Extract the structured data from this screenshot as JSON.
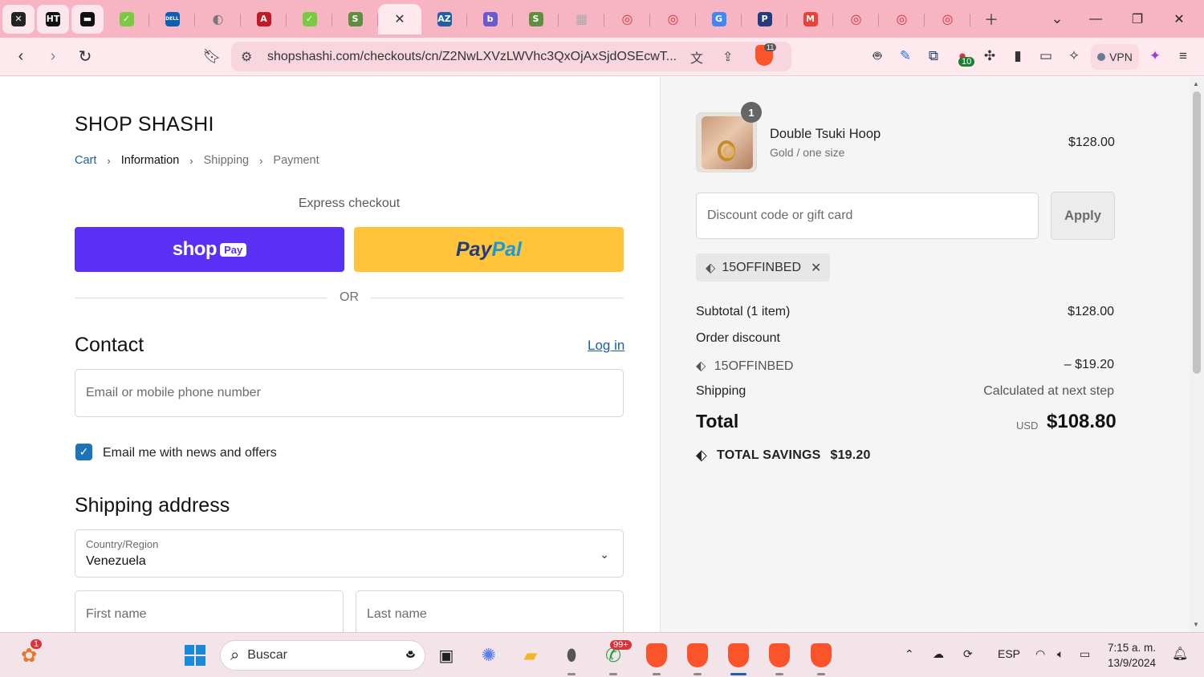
{
  "tabs": [
    {
      "icon": "x-app-icon",
      "color": "#222222",
      "glyph": "✕"
    },
    {
      "icon": "ht-icon",
      "color": "#111111",
      "glyph": "HT"
    },
    {
      "icon": "terminal-app-icon",
      "color": "#111111",
      "glyph": "▬"
    },
    {
      "icon": "green-leaf-icon",
      "color": "#7ac943",
      "glyph": "✓"
    },
    {
      "icon": "dell-icon",
      "color": "#0a5eb3",
      "glyph": "DELL"
    },
    {
      "icon": "globe-icon",
      "color": "#777777",
      "glyph": "◐"
    },
    {
      "icon": "script-a-icon",
      "color": "#c01a26",
      "glyph": "A"
    },
    {
      "icon": "green-leaf-icon",
      "color": "#7ac943",
      "glyph": "✓"
    },
    {
      "icon": "shopify-icon",
      "color": "#5e8e3e",
      "glyph": "S"
    },
    {
      "icon": "close-tab-icon",
      "color": "#333333",
      "glyph": "✕",
      "active": true
    },
    {
      "icon": "az-icon",
      "color": "#1f5fa8",
      "glyph": "AZ"
    },
    {
      "icon": "better-icon",
      "color": "#6a5acd",
      "glyph": "b"
    },
    {
      "icon": "shopify-icon",
      "color": "#5e8e3e",
      "glyph": "S"
    },
    {
      "icon": "grey-grid-icon",
      "color": "#aaaaaa",
      "glyph": "▦"
    },
    {
      "icon": "brave-target-icon",
      "color": "#d6353a",
      "glyph": "◎"
    },
    {
      "icon": "brave-target-icon",
      "color": "#d6353a",
      "glyph": "◎"
    },
    {
      "icon": "translate-icon",
      "color": "#4285f4",
      "glyph": "G"
    },
    {
      "icon": "paypal-icon",
      "color": "#253b80",
      "glyph": "P"
    },
    {
      "icon": "gmail-icon",
      "color": "#ea4335",
      "glyph": "M"
    },
    {
      "icon": "brave-target-icon",
      "color": "#d6353a",
      "glyph": "◎"
    },
    {
      "icon": "brave-target-icon",
      "color": "#d6353a",
      "glyph": "◎"
    },
    {
      "icon": "brave-target-icon",
      "color": "#d6353a",
      "glyph": "◎"
    }
  ],
  "browser": {
    "url": "shopshashi.com/checkouts/cn/Z2NwLXVzLWVhc3QxOjAxSjdOSEcwT...",
    "brave_badge": "11",
    "vpn_label": "VPN",
    "ext_badge": "10"
  },
  "checkout": {
    "shop_name": "SHOP SHASHI",
    "breadcrumbs": [
      {
        "label": "Cart"
      },
      {
        "label": "Information"
      },
      {
        "label": "Shipping"
      },
      {
        "label": "Payment"
      }
    ],
    "express_label": "Express checkout",
    "shoppay_word": "shop",
    "shoppay_pay": "Pay",
    "paypal_part1": "Pay",
    "paypal_part2": "Pal",
    "or_label": "OR",
    "contact_heading": "Contact",
    "login_label": "Log in",
    "email_placeholder": "Email or mobile phone number",
    "newsletter_label": "Email me with news and offers",
    "newsletter_checked": true,
    "shipping_heading": "Shipping address",
    "country_label": "Country/Region",
    "country_value": "Venezuela",
    "first_name_placeholder": "First name",
    "last_name_placeholder": "Last name"
  },
  "summary": {
    "quantity": "1",
    "product_name": "Double Tsuki Hoop",
    "product_variant": "Gold / one size",
    "product_price": "$128.00",
    "discount_placeholder": "Discount code or gift card",
    "apply_label": "Apply",
    "applied_code": "15OFFINBED",
    "subtotal_label": "Subtotal (1 item)",
    "subtotal_value": "$128.00",
    "order_discount_label": "Order discount",
    "discount_code": "15OFFINBED",
    "discount_value": "– $19.20",
    "shipping_label": "Shipping",
    "shipping_value": "Calculated at next step",
    "total_label": "Total",
    "total_currency": "USD",
    "total_value": "$108.80",
    "savings_label": "TOTAL SAVINGS",
    "savings_value": "$19.20"
  },
  "taskbar": {
    "notif_badge": "1",
    "search_label": "Buscar",
    "whatsapp_badge": "99+",
    "language": "ESP",
    "time": "7:15 a. m.",
    "date": "13/9/2024"
  }
}
